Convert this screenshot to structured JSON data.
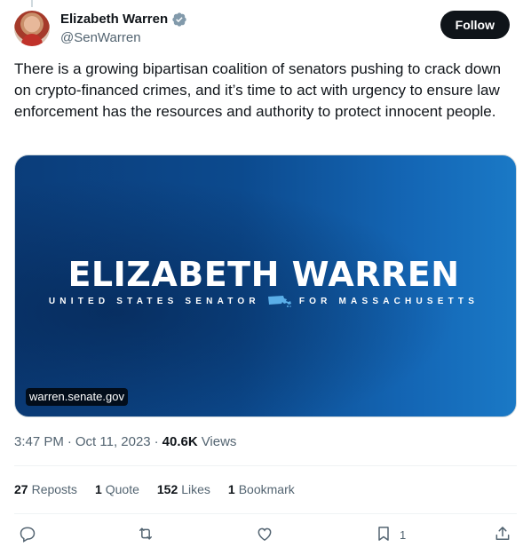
{
  "author": {
    "display_name": "Elizabeth Warren",
    "handle": "@SenWarren",
    "verified_icon": "verified-badge-icon"
  },
  "follow_label": "Follow",
  "tweet": {
    "text": "There is a growing bipartisan coalition of senators pushing to crack down on crypto-financed crimes, and it’s time to act with urgency to ensure law enforcement has the resources and authority to protect innocent people."
  },
  "media": {
    "banner_title": "ELIZABETH WARREN",
    "banner_sub_left": "UNITED STATES SENATOR",
    "banner_sub_right": "FOR MASSACHUSETTS",
    "link_domain": "warren.senate.gov"
  },
  "meta": {
    "time": "3:47 PM",
    "sep1": "·",
    "date": "Oct 11, 2023",
    "sep2": "·",
    "views_count": "40.6K",
    "views_label": "Views"
  },
  "stats": {
    "reposts_count": "27",
    "reposts_label": "Reposts",
    "quotes_count": "1",
    "quotes_label": "Quote",
    "likes_count": "152",
    "likes_label": "Likes",
    "bookmarks_count": "1",
    "bookmarks_label": "Bookmark"
  },
  "actions": {
    "bookmark_count": "1"
  },
  "colors": {
    "text": "#0f1419",
    "secondary": "#536471",
    "banner_blue": "#0c4a8e",
    "verified": "#829aab"
  }
}
